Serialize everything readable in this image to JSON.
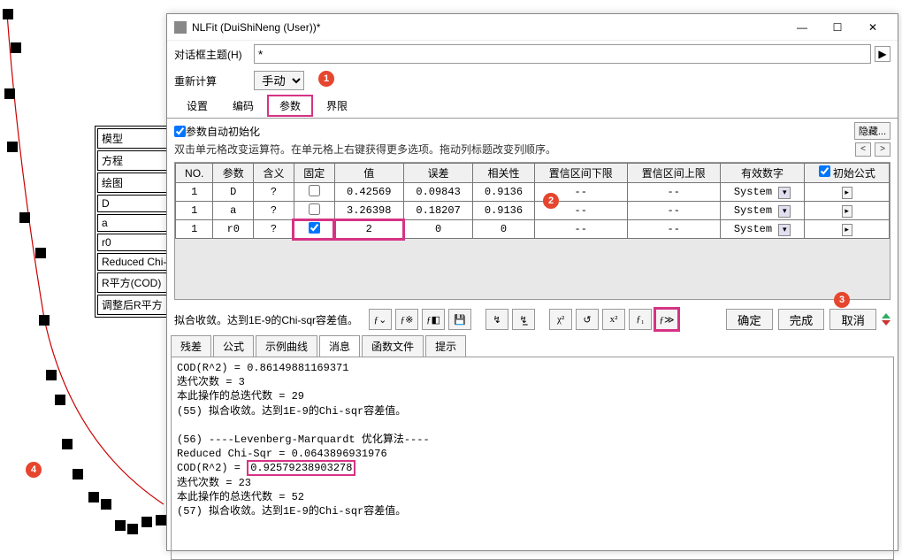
{
  "window_title": "NLFit (DuiShiNeng (User))*",
  "header": {
    "theme_label": "对话框主题(H)",
    "theme_value": "*",
    "recalc_label": "重新计算",
    "recalc_value": "手动"
  },
  "main_tabs": [
    "设置",
    "编码",
    "参数",
    "界限"
  ],
  "auto_init_label": "参数自动初始化",
  "hide_btn": "隐藏...",
  "hint_text": "双击单元格改变运算符。在单元格上右键获得更多选项。拖动列标题改变列顺序。",
  "grid": {
    "headers": [
      "NO.",
      "参数",
      "含义",
      "固定",
      "值",
      "误差",
      "相关性",
      "置信区间下限",
      "置信区间上限",
      "有效数字",
      "初始公式"
    ],
    "init_formula_checked": true,
    "rows": [
      {
        "no": "1",
        "param": "D",
        "meaning": "?",
        "fixed": false,
        "value": "0.42569",
        "err": "0.09843",
        "corr": "0.9136",
        "ci_lo": "--",
        "ci_hi": "--",
        "sig": "System"
      },
      {
        "no": "1",
        "param": "a",
        "meaning": "?",
        "fixed": false,
        "value": "3.26398",
        "err": "0.18207",
        "corr": "0.9136",
        "ci_lo": "--",
        "ci_hi": "--",
        "sig": "System"
      },
      {
        "no": "1",
        "param": "r0",
        "meaning": "?",
        "fixed": true,
        "value": "2",
        "err": "0",
        "corr": "0",
        "ci_lo": "--",
        "ci_hi": "--",
        "sig": "System"
      }
    ]
  },
  "status_text": "拟合收敛。达到1E-9的Chi-sqr容差值。",
  "buttons": {
    "ok": "确定",
    "done": "完成",
    "cancel": "取消"
  },
  "bottom_tabs": [
    "残差",
    "公式",
    "示例曲线",
    "消息",
    "函数文件",
    "提示"
  ],
  "log": {
    "line1": "COD(R^2) = 0.86149881169371",
    "line2": "迭代次数 = 3",
    "line3": "本此操作的总迭代数 = 29",
    "line4": "(55) 拟合收敛。达到1E-9的Chi-sqr容差值。",
    "line5": "",
    "line6": "(56) ----Levenberg-Marquardt 优化算法----",
    "line7": "Reduced Chi-Sqr = 0.0643896931976",
    "line8a": "COD(R^2) = ",
    "line8b": "0.92579238903278",
    "line9": "迭代次数 = 23",
    "line10": "本此操作的总迭代数 = 52",
    "line11": "(57) 拟合收敛。达到1E-9的Chi-sqr容差值。"
  },
  "bg_table_rows": [
    "模型",
    "方程",
    "绘图",
    "D",
    "a",
    "r0",
    "Reduced Chi-",
    "R平方(COD)",
    "调整后R平方"
  ],
  "badges": {
    "b1": "1",
    "b2": "2",
    "b3": "3",
    "b4": "4"
  },
  "chart_data": {
    "type": "scatter",
    "note": "Background fitted curve with scattered data points; axes not visible in crop.",
    "series": [
      {
        "name": "data-points",
        "x": [
          0.3,
          0.5,
          0.7,
          1.0,
          1.2,
          1.4,
          2.0,
          2.3,
          2.6,
          3.0,
          3.5,
          4.0,
          4.3,
          4.6,
          5.0,
          5.2,
          5.4,
          5.6
        ],
        "y": [
          9.5,
          7.8,
          6.0,
          5.0,
          4.2,
          3.5,
          2.8,
          2.3,
          1.8,
          1.4,
          1.1,
          0.9,
          0.7,
          0.6,
          0.5,
          0.45,
          0.45,
          0.4
        ]
      },
      {
        "name": "fit-curve",
        "type": "line",
        "color": "#cc0000"
      }
    ]
  }
}
